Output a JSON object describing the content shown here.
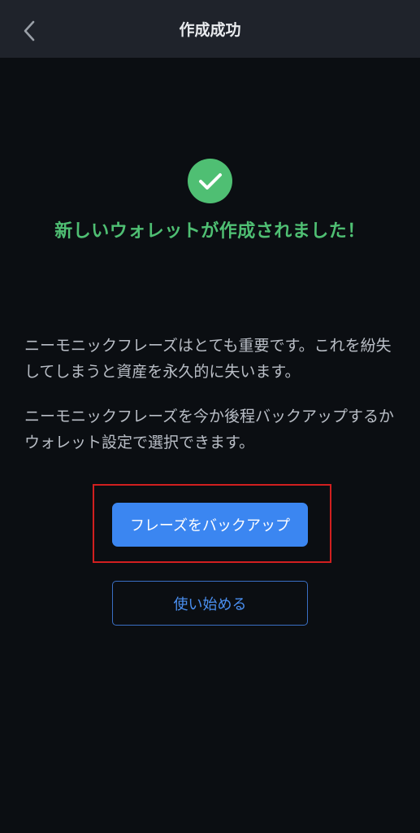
{
  "header": {
    "title": "作成成功",
    "back_icon": "chevron-left-icon"
  },
  "success": {
    "icon": "check-circle-icon",
    "message": "新しいウォレットが作成されました！",
    "accent_color": "#4fbf73"
  },
  "body": {
    "paragraph1": "ニーモニックフレーズはとても重要です。これを紛失してしまうと資産を永久的に失います。",
    "paragraph2": "ニーモニックフレーズを今か後程バックアップするかウォレット設定で選択できます。"
  },
  "actions": {
    "backup_label": "フレーズをバックアップ",
    "start_label": "使い始める",
    "primary_color": "#3b86f1",
    "highlight_color": "#d11f1f"
  }
}
